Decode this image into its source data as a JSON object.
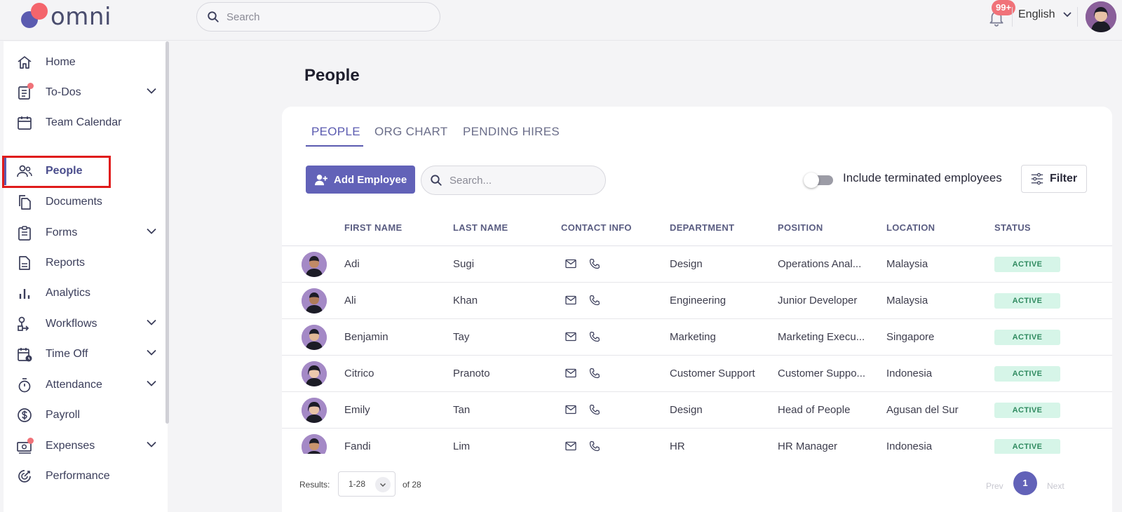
{
  "header": {
    "logo_text": "omni",
    "search_placeholder": "Search",
    "notifications_badge": "99+",
    "language": "English"
  },
  "sidebar": {
    "items": [
      {
        "label": "Home",
        "icon": "home-icon",
        "has_chevron": false
      },
      {
        "label": "To-Dos",
        "icon": "todos-icon",
        "has_chevron": true,
        "has_dot": true
      },
      {
        "label": "Team Calendar",
        "icon": "calendar-icon",
        "has_chevron": false
      },
      {
        "label": "People",
        "icon": "people-icon",
        "has_chevron": false,
        "active": true
      },
      {
        "label": "Documents",
        "icon": "documents-icon",
        "has_chevron": false
      },
      {
        "label": "Forms",
        "icon": "forms-icon",
        "has_chevron": true
      },
      {
        "label": "Reports",
        "icon": "reports-icon",
        "has_chevron": false
      },
      {
        "label": "Analytics",
        "icon": "analytics-icon",
        "has_chevron": false
      },
      {
        "label": "Workflows",
        "icon": "workflows-icon",
        "has_chevron": true
      },
      {
        "label": "Time Off",
        "icon": "time-off-icon",
        "has_chevron": true
      },
      {
        "label": "Attendance",
        "icon": "stopwatch-icon",
        "has_chevron": true
      },
      {
        "label": "Payroll",
        "icon": "dollar-icon",
        "has_chevron": false
      },
      {
        "label": "Expenses",
        "icon": "expenses-icon",
        "has_chevron": true,
        "has_dot": true
      },
      {
        "label": "Performance",
        "icon": "performance-icon",
        "has_chevron": false
      }
    ]
  },
  "main": {
    "title": "People",
    "tabs": [
      "PEOPLE",
      "ORG CHART",
      "PENDING HIRES"
    ],
    "add_button": "Add Employee",
    "search_placeholder": "Search...",
    "toggle_label": "Include terminated employees",
    "filter_button": "Filter",
    "columns": [
      "FIRST NAME",
      "LAST NAME",
      "CONTACT INFO",
      "DEPARTMENT",
      "POSITION",
      "LOCATION",
      "STATUS"
    ],
    "rows": [
      {
        "first": "Adi",
        "last": "Sugi",
        "department": "Design",
        "position": "Operations Anal...",
        "location": "Malaysia",
        "status": "ACTIVE"
      },
      {
        "first": "Ali",
        "last": "Khan",
        "department": "Engineering",
        "position": "Junior Developer",
        "location": "Malaysia",
        "status": "ACTIVE"
      },
      {
        "first": "Benjamin",
        "last": "Tay",
        "department": "Marketing",
        "position": "Marketing Execu...",
        "location": "Singapore",
        "status": "ACTIVE"
      },
      {
        "first": "Citrico",
        "last": "Pranoto",
        "department": "Customer Support",
        "position": "Customer Suppo...",
        "location": "Indonesia",
        "status": "ACTIVE"
      },
      {
        "first": "Emily",
        "last": "Tan",
        "department": "Design",
        "position": "Head of People",
        "location": "Agusan del Sur",
        "status": "ACTIVE"
      },
      {
        "first": "Fandi",
        "last": "Lim",
        "department": "HR",
        "position": "HR Manager",
        "location": "Indonesia",
        "status": "ACTIVE"
      }
    ],
    "pagination": {
      "results_label": "Results:",
      "range": "1-28",
      "of_label": "of 28",
      "prev": "Prev",
      "page": "1",
      "next": "Next"
    }
  },
  "colors": {
    "accent": "#5b5bb0",
    "badge_red": "#f07279",
    "status_bg": "#d6f5e8",
    "status_text": "#2f8a5f"
  }
}
